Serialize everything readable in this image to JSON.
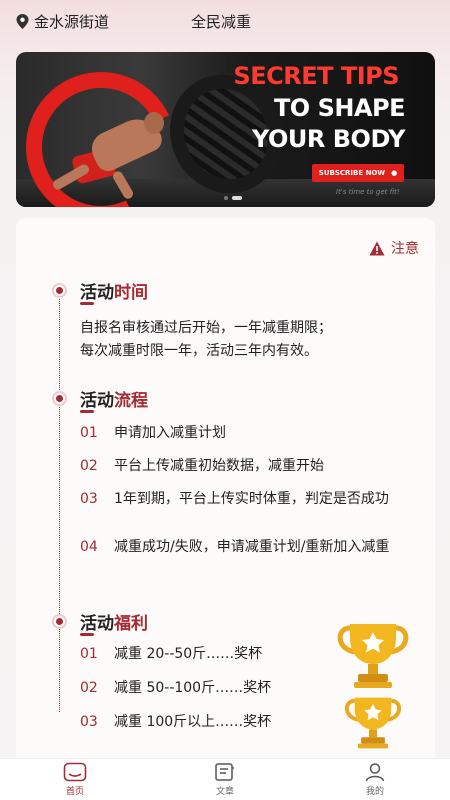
{
  "header": {
    "location": "金水源街道",
    "title": "全民减重"
  },
  "banner": {
    "line1": "SECRET TIPS",
    "line2": "TO SHAPE",
    "line3": "YOUR BODY",
    "button": "SUBSCRIBE NOW",
    "tagline": "It's time to get fit!"
  },
  "notice": "注意",
  "sections": {
    "time": {
      "title_a": "活动",
      "title_b": "时间",
      "line1": "自报名审核通过后开始，一年减重期限；",
      "line2": "每次减重时限一年，活动三年内有效。"
    },
    "process": {
      "title_a": "活动",
      "title_b": "流程",
      "items": [
        {
          "num": "01",
          "text": "申请加入减重计划"
        },
        {
          "num": "02",
          "text": "平台上传减重初始数据，减重开始"
        },
        {
          "num": "03",
          "text": "1年到期，平台上传实时体重，判定是否成功"
        },
        {
          "num": "04",
          "text": "减重成功/失败，申请减重计划/重新加入减重"
        }
      ]
    },
    "benefit": {
      "title_a": "活动",
      "title_b": "福利",
      "items": [
        {
          "num": "01",
          "text": "减重 20--50斤……奖杯"
        },
        {
          "num": "02",
          "text": "减重 50--100斤……奖杯"
        },
        {
          "num": "03",
          "text": "减重 100斤以上……奖杯"
        }
      ]
    }
  },
  "tabs": [
    {
      "label": "首页",
      "icon": "home-icon",
      "active": true
    },
    {
      "label": "文章",
      "icon": "article-icon",
      "active": false
    },
    {
      "label": "我的",
      "icon": "user-icon",
      "active": false
    }
  ],
  "colors": {
    "accent": "#a32b33",
    "banner_red": "#e0201c"
  }
}
